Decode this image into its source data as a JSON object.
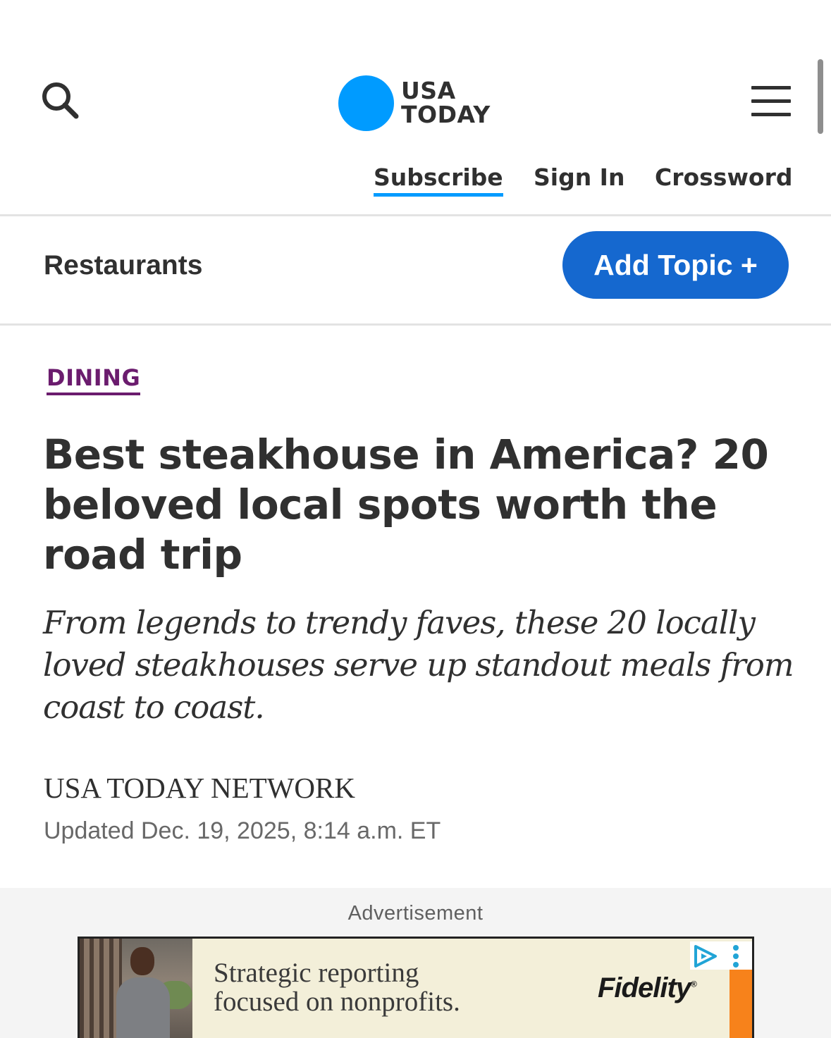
{
  "header": {
    "logo_line1": "USA",
    "logo_line2": "TODAY",
    "nav": {
      "subscribe": "Subscribe",
      "sign_in": "Sign In",
      "crossword": "Crossword"
    }
  },
  "topic_bar": {
    "label": "Restaurants",
    "add_topic": "Add Topic +"
  },
  "article": {
    "kicker": "DINING",
    "headline": "Best steakhouse in America? 20 beloved local spots worth the road trip",
    "dek": "From legends to trendy faves, these 20 locally loved steakhouses serve up standout meals from coast to coast.",
    "byline": "USA TODAY NETWORK",
    "timestamp": "Updated Dec. 19, 2025, 8:14 a.m. ET"
  },
  "ad": {
    "label": "Advertisement",
    "copy_line1": "Strategic reporting",
    "copy_line2": "focused on nonprofits.",
    "brand": "Fidelity",
    "brand_mark": "®"
  },
  "colors": {
    "logo_blue": "#009bff",
    "button_blue": "#1568cf",
    "kicker_purple": "#6b1c6e",
    "text": "#303030",
    "ad_orange": "#f7821b"
  }
}
